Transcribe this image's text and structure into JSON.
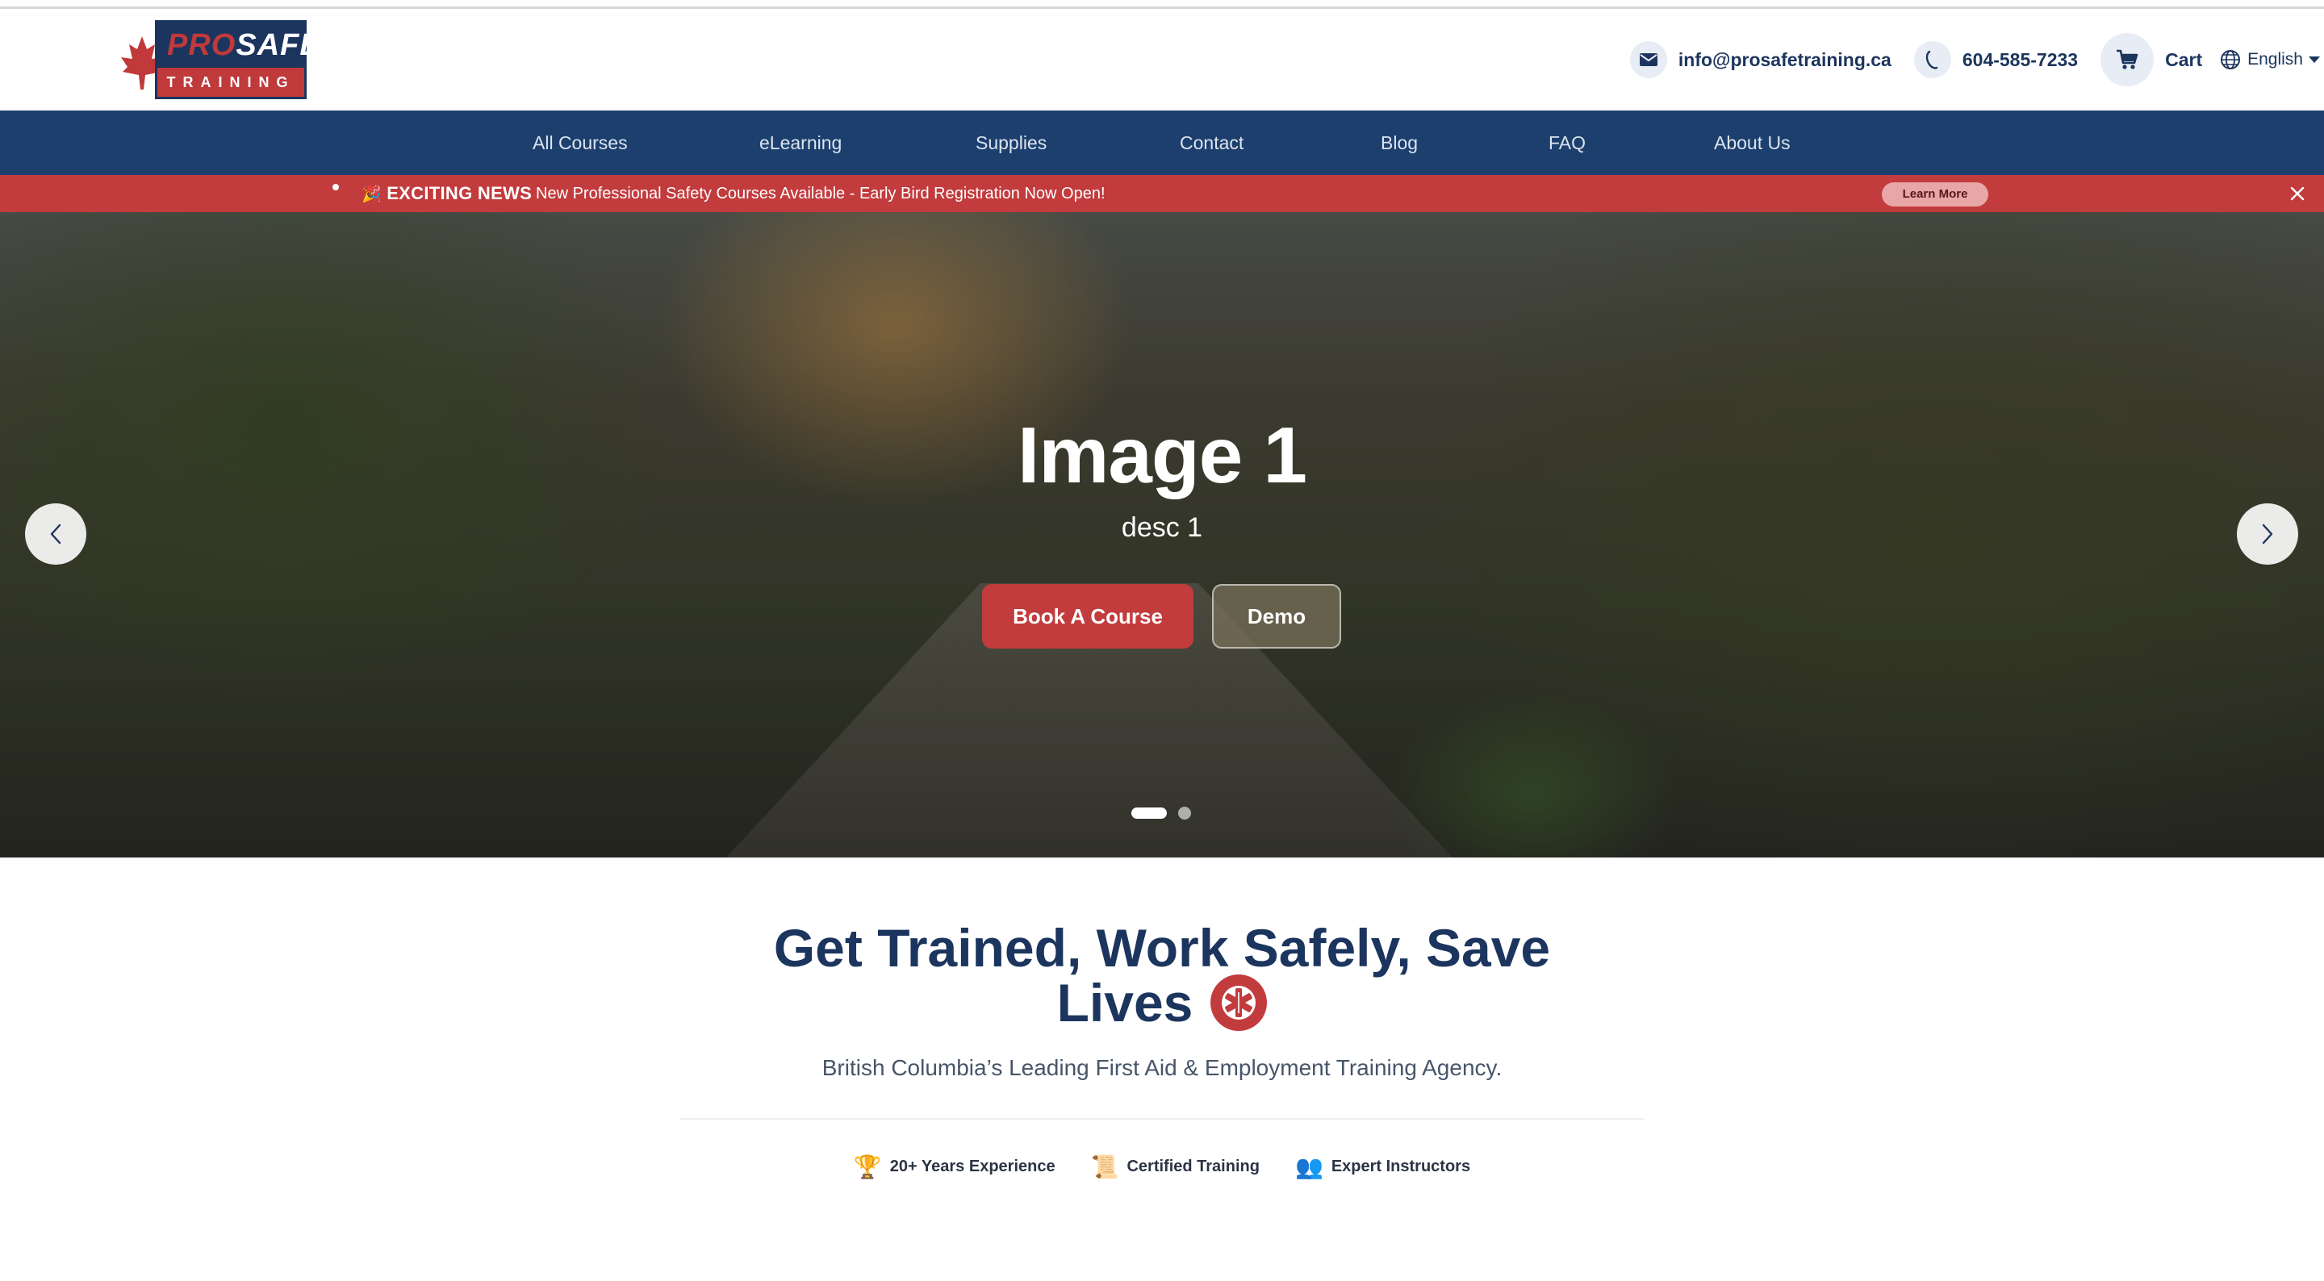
{
  "header": {
    "logo_top": "PRO",
    "logo_top_accent": "SAFE",
    "logo_bottom": "TRAINING",
    "email": "info@prosafetraining.ca",
    "phone": "604-585-7233",
    "cart_label": "Cart",
    "language": "English"
  },
  "nav": {
    "items": [
      "All Courses",
      "eLearning",
      "Supplies",
      "Contact",
      "Blog",
      "FAQ",
      "About Us"
    ]
  },
  "announcement": {
    "icon": "🎉",
    "label": "EXCITING NEWS",
    "message": "New Professional Safety Courses Available - Early Bird Registration Now Open!",
    "button": "Learn More"
  },
  "hero": {
    "title": "Image 1",
    "description": "desc 1",
    "primary_button": "Book A Course",
    "secondary_button": "Demo",
    "slide_count": 2,
    "active_slide": 1
  },
  "intro": {
    "heading_line1": "Get Trained, Work Safely, Save",
    "heading_line2": "Lives",
    "subheading": "British Columbia’s Leading First Aid & Employment Training Agency."
  },
  "features": [
    {
      "icon": "trophy-icon",
      "glyph": "🏆",
      "label": "20+ Years Experience"
    },
    {
      "icon": "certificate-icon",
      "glyph": "📜",
      "label": "Certified Training"
    },
    {
      "icon": "instructors-icon",
      "glyph": "👥",
      "label": "Expert Instructors"
    }
  ],
  "colors": {
    "navy": "#1c355e",
    "nav_bar": "#1c3f6e",
    "accent_red": "#c23b3d"
  }
}
